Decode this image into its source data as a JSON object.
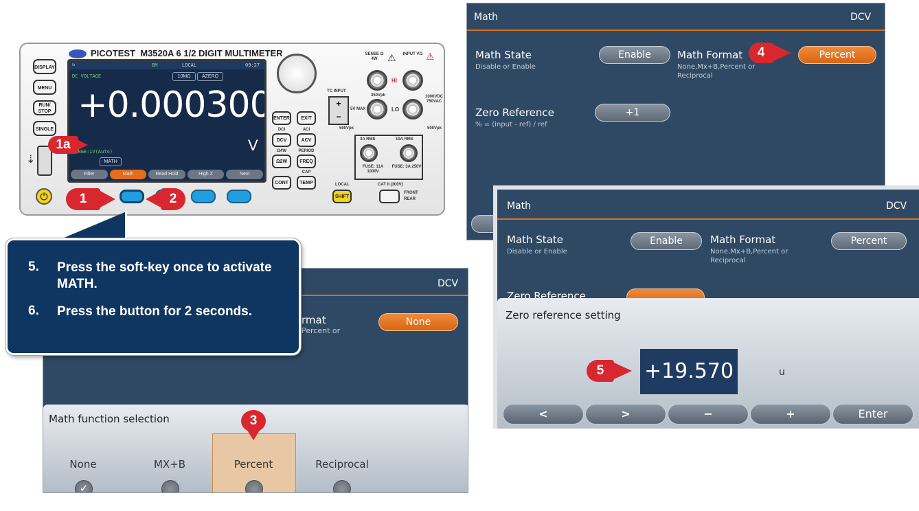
{
  "instrument": {
    "brand": "PICOTEST",
    "model": "M3520A 6 1/2 DIGIT MULTIMETER",
    "side_keys": [
      "DISPLAY",
      "MENU",
      "RUN/ STOP",
      "SINGLE"
    ],
    "lcd": {
      "status_local": "LOCAL",
      "status_time": "09:27",
      "status_indicator": "BM",
      "mode": "DC VOLTAGE",
      "btn_impedance": "10MΩ",
      "btn_azero": "AZERO",
      "reading": "+0.000300",
      "unit": "V",
      "range": "RANGE:1V(Auto)",
      "math_indicator": "MATH",
      "softkeys": [
        "Filter",
        "Math",
        "Read Hold",
        "High Z",
        "Next"
      ]
    },
    "keys": {
      "enter": "ENTER",
      "exit": "EXIT",
      "dci": "DCI",
      "aci": "ACI",
      "dcv": "DCV",
      "acv": "ACV",
      "o4w": "Ω4W",
      "period": "PERIOD",
      "o2w": "Ω2W",
      "freq": "FREQ",
      "cap": "CAP",
      "cont": "CONT",
      "temp": "TEMP",
      "local": "LOCAL",
      "shift": "SHIFT"
    },
    "terminals": {
      "tc_input": "TC INPUT",
      "sense": "SENSE Ω 4W",
      "input": "INPUT VΩ",
      "hi": "HI",
      "lo": "LO",
      "v5max": "5V MAX",
      "v350": "350Vpk",
      "v1000": "1000VDC 750VAC",
      "v500a": "500Vpk",
      "v500b": "500Vpk",
      "a3": "3A RMS",
      "a10": "10A RMS",
      "fuse1": "FUSE: 11A 1000V",
      "fuse2": "FUSE: 3A 250V",
      "cat": "CAT II (300V)",
      "front": "FRONT",
      "rear": "REAR"
    }
  },
  "badges": {
    "b1": "1",
    "b1a": "1a",
    "b2": "2",
    "b3": "3",
    "b4": "4",
    "b5": "5"
  },
  "callout": {
    "items": [
      "Press the soft-key once to activate MATH.",
      "Press the button for 2 seconds."
    ],
    "numbers": [
      "5.",
      "6."
    ]
  },
  "panel_top_right": {
    "title": "Math",
    "mode": "DCV",
    "math_state_label": "Math State",
    "math_state_sub": "Disable or Enable",
    "math_state_btn": "Enable",
    "math_format_label": "Math Format",
    "math_format_sub": "None,Mx+B,Percent or Reciprocal",
    "math_format_btn": "Percent",
    "zero_ref_label": "Zero Reference",
    "zero_ref_sub": "% = (input - ref) / ref",
    "zero_ref_btn": "+1"
  },
  "panel_bottom_left": {
    "mode": "DCV",
    "math_format_label_partial": "rmat",
    "math_format_sub_partial": "Percent or",
    "math_format_btn": "None",
    "selection_title": "Math function selection",
    "options": [
      "None",
      "MX+B",
      "Percent",
      "Reciprocal"
    ],
    "checkmark": "✓"
  },
  "panel_bottom_right": {
    "title": "Math",
    "mode": "DCV",
    "math_state_label": "Math State",
    "math_state_sub": "Disable or Enable",
    "math_state_btn": "Enable",
    "math_format_label": "Math Format",
    "math_format_sub": "None,Mx+B,Percent or Reciprocal",
    "math_format_btn": "Percent",
    "zero_ref_partial": "Zero Reference",
    "dialog_title": "Zero reference setting",
    "value": "+19.570",
    "unit": "u",
    "nav": [
      "<",
      ">",
      "−",
      "+",
      "Enter"
    ]
  },
  "colors": {
    "accent_orange": "#e36d1b",
    "badge_red": "#d8272e",
    "panel_blue": "#2f4964",
    "callout_navy": "#0f3561",
    "softkey_blue": "#1f9ee0"
  }
}
